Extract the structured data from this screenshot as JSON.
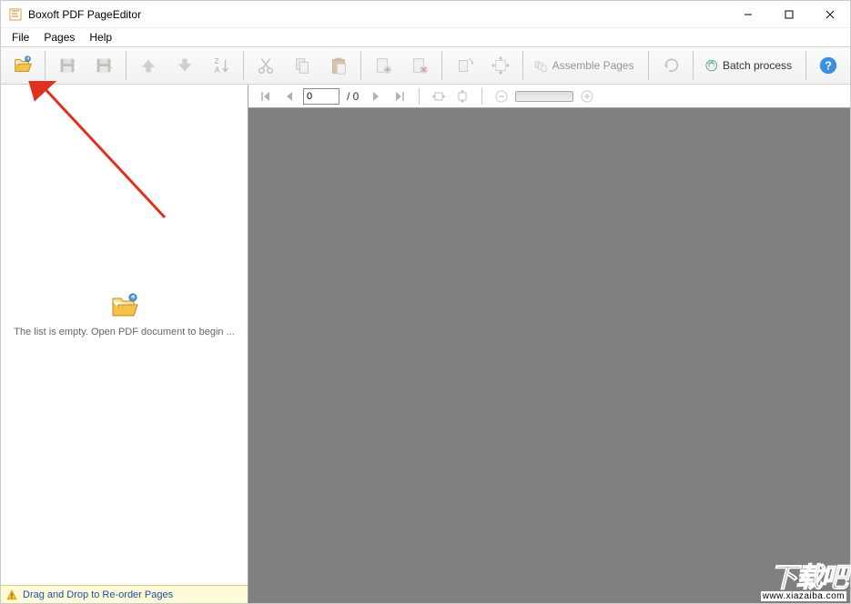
{
  "app": {
    "title": "Boxoft PDF PageEditor"
  },
  "menu": {
    "file": "File",
    "pages": "Pages",
    "help": "Help"
  },
  "toolbar": {
    "assemble_label": "Assemble Pages",
    "batch_label": "Batch process"
  },
  "sidebar": {
    "empty_text": "The list is empty. Open  PDF document to begin ...",
    "footer_text": "Drag and Drop to Re-order Pages"
  },
  "preview": {
    "page_input": "0",
    "page_total": "/ 0"
  },
  "watermark": {
    "big": "下载吧",
    "small": "www.xiazaiba.com"
  }
}
